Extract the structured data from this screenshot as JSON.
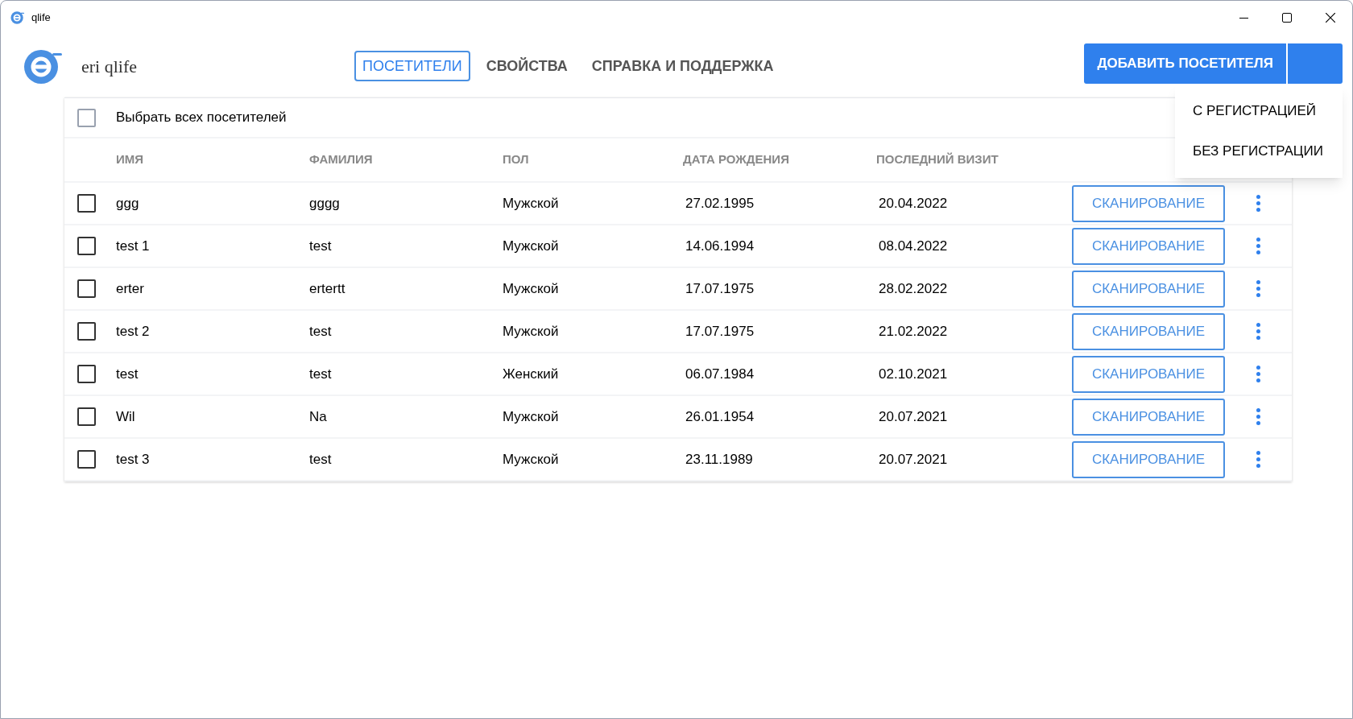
{
  "window": {
    "title": "qlife"
  },
  "app": {
    "name": "eri qlife"
  },
  "tabs": [
    {
      "label": "ПОСЕТИТЕЛИ",
      "selected": true
    },
    {
      "label": "СВОЙСТВА",
      "selected": false
    },
    {
      "label": "СПРАВКА И ПОДДЕРЖКА",
      "selected": false
    }
  ],
  "add_button": {
    "label": "ДОБАВИТЬ ПОСЕТИТЕЛЯ"
  },
  "add_menu": [
    "С РЕГИСТРАЦИЕЙ",
    "БЕЗ РЕГИСТРАЦИИ"
  ],
  "select_all": {
    "label": "Выбрать всех посетителей",
    "checked": false
  },
  "table": {
    "columns": [
      "ИМЯ",
      "ФАМИЛИЯ",
      "ПОЛ",
      "ДАТА РОЖДЕНИЯ",
      "ПОСЛЕДНИЙ ВИЗИТ"
    ],
    "rows": [
      {
        "checked": false,
        "cells": [
          "ggg",
          "gggg",
          "Мужской",
          "27.02.1995",
          "20.04.2022"
        ],
        "action": "СКАНИРОВАНИЕ"
      },
      {
        "checked": false,
        "cells": [
          "test 1",
          "test",
          "Мужской",
          "14.06.1994",
          "08.04.2022"
        ],
        "action": "СКАНИРОВАНИЕ"
      },
      {
        "checked": false,
        "cells": [
          "erter",
          "ertertt",
          "Мужской",
          "17.07.1975",
          "28.02.2022"
        ],
        "action": "СКАНИРОВАНИЕ"
      },
      {
        "checked": false,
        "cells": [
          "test 2",
          "test",
          "Мужской",
          "17.07.1975",
          "21.02.2022"
        ],
        "action": "СКАНИРОВАНИЕ"
      },
      {
        "checked": false,
        "cells": [
          "test",
          "test",
          "Женский",
          "06.07.1984",
          "02.10.2021"
        ],
        "action": "СКАНИРОВАНИЕ"
      },
      {
        "checked": false,
        "cells": [
          "Wil",
          "Na",
          "Мужской",
          "26.01.1954",
          "20.07.2021"
        ],
        "action": "СКАНИРОВАНИЕ"
      },
      {
        "checked": false,
        "cells": [
          "test 3",
          "test",
          "Мужской",
          "23.11.1989",
          "20.07.2021"
        ],
        "action": "СКАНИРОВАНИЕ"
      }
    ]
  }
}
